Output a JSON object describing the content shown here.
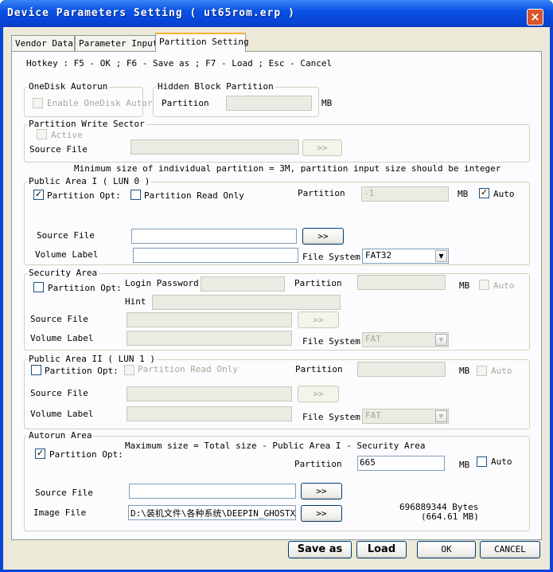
{
  "window": {
    "title": "Device Parameters Setting ( ut65rom.erp )",
    "close_glyph": "×"
  },
  "tabs": [
    "Vendor Data",
    "Parameter Input",
    "Partition Setting"
  ],
  "hotkey": "Hotkey : F5 - OK ; F6 - Save as ; F7 - Load ; Esc - Cancel",
  "onedisk": {
    "title": "OneDisk Autorun",
    "enable_label": "Enable OneDisk Autor"
  },
  "hidden": {
    "title": "Hidden Block Partition",
    "partition_label": "Partition",
    "unit": "MB"
  },
  "pws": {
    "title": "Partition Write Sector",
    "active_label": "Active",
    "source_label": "Source File",
    "browse": ">>"
  },
  "min_note": "Minimum size of individual partition = 3M, partition input size should be integer",
  "public1": {
    "title": "Public Area I ( LUN 0 )",
    "opt_label": "Partition Opt:",
    "readonly_label": "Partition Read Only",
    "partition_label": "Partition",
    "partition_value": "-1",
    "unit": "MB",
    "auto_label": "Auto",
    "source_label": "Source File",
    "volume_label": "Volume Label",
    "fs_label": "File System",
    "fs_value": "FAT32",
    "browse": ">>"
  },
  "security": {
    "title": "Security Area",
    "opt_label": "Partition Opt:",
    "login_label": "Login Password",
    "partition_label": "Partition",
    "unit": "MB",
    "auto_label": "Auto",
    "hint_label": "Hint",
    "source_label": "Source File",
    "volume_label": "Volume Label",
    "fs_label": "File System",
    "fs_value": "FAT",
    "browse": ">>"
  },
  "public2": {
    "title": "Public Area II ( LUN 1 )",
    "opt_label": "Partition Opt:",
    "readonly_label": "Partition Read Only",
    "partition_label": "Partition",
    "unit": "MB",
    "auto_label": "Auto",
    "source_label": "Source File",
    "volume_label": "Volume Label",
    "fs_label": "File System",
    "fs_value": "FAT",
    "browse": ">>"
  },
  "autorun": {
    "title": "Autorun Area",
    "note": "Maximum size = Total size - Public Area I - Security Area",
    "opt_label": "Partition Opt:",
    "partition_label": "Partition",
    "partition_value": "665",
    "unit": "MB",
    "auto_label": "Auto",
    "source_label": "Source File",
    "image_label": "Image File",
    "image_value": "D:\\装机文件\\各种系统\\DEEPIN_GHOSTX",
    "bytes": "696889344 Bytes",
    "mb": "(664.61 MB)",
    "browse": ">>"
  },
  "buttons": {
    "save_as": "Save as",
    "load": "Load",
    "ok": "OK",
    "cancel": "CANCEL"
  },
  "colors": {
    "titlebar": "#0a52e4",
    "dialog_bg": "#ece9d8",
    "check": "#21a121"
  }
}
